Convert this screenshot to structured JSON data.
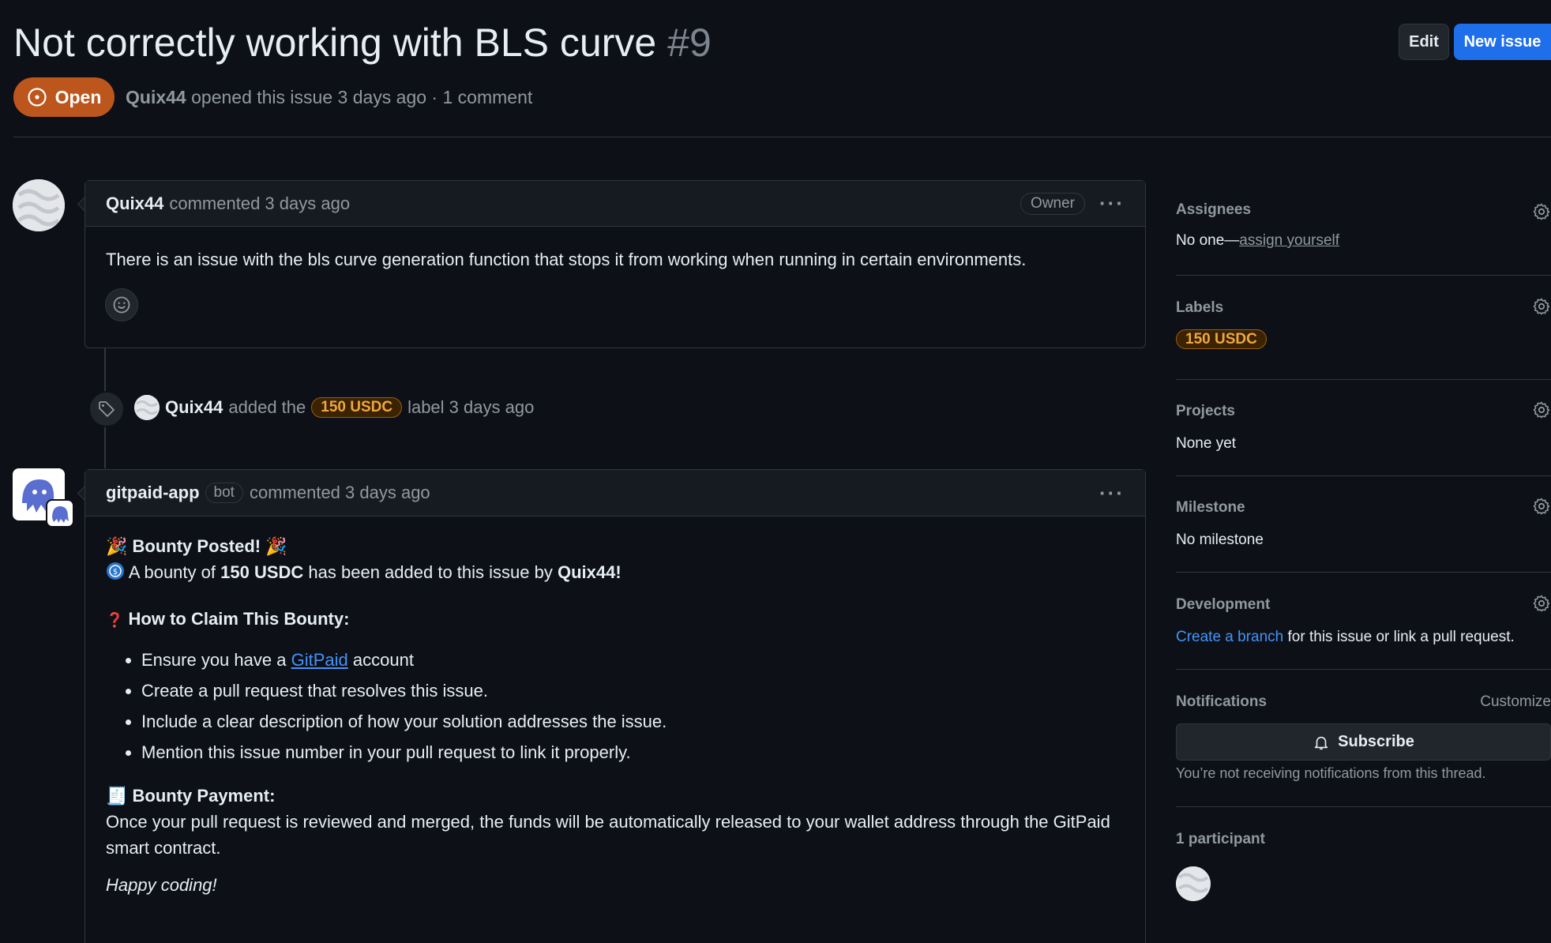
{
  "issue": {
    "title": "Not correctly working with BLS curve",
    "number": "#9",
    "state": "Open",
    "author": "Quix44",
    "meta_text": "opened this issue 3 days ago · 1 comment"
  },
  "header_buttons": {
    "edit": "Edit",
    "new_issue": "New issue"
  },
  "first_comment": {
    "author": "Quix44",
    "time": "commented 3 days ago",
    "role_badge": "Owner",
    "body": "There is an issue with the bls curve generation function that stops it from working when running in certain environments."
  },
  "label_event": {
    "actor": "Quix44",
    "text_before": "added the",
    "label": "150 USDC",
    "text_after": "label 3 days ago"
  },
  "bot_comment": {
    "author": "gitpaid-app",
    "badge": "bot",
    "time": "commented 3 days ago",
    "heading": "Bounty Posted!",
    "party_emoji": "🎉",
    "bounty_line": {
      "prefix": "A bounty of",
      "amount": "150 USDC",
      "middle": "has been added to this issue by",
      "user": "Quix44!"
    },
    "claim_heading": "How to Claim This Bounty:",
    "question_emoji": "❓",
    "steps": {
      "s1_prefix": "Ensure you have a",
      "s1_link": "GitPaid",
      "s1_suffix": "account",
      "s2": "Create a pull request that resolves this issue.",
      "s3": "Include a clear description of how your solution addresses the issue.",
      "s4": "Mention this issue number in your pull request to link it properly."
    },
    "payment_heading": "Bounty Payment:",
    "payment_emoji": "🧾",
    "payment_text": "Once your pull request is reviewed and merged, the funds will be automatically released to your wallet address through the GitPaid smart contract.",
    "closing": "Happy coding!"
  },
  "sidebar": {
    "assignees": {
      "title": "Assignees",
      "value_prefix": "No one—",
      "link": "assign yourself"
    },
    "labels": {
      "title": "Labels",
      "label": "150 USDC"
    },
    "projects": {
      "title": "Projects",
      "value": "None yet"
    },
    "milestone": {
      "title": "Milestone",
      "value": "No milestone"
    },
    "development": {
      "title": "Development",
      "link": "Create a branch",
      "suffix": "for this issue or link a pull request."
    },
    "notifications": {
      "title": "Notifications",
      "customize": "Customize",
      "subscribe": "Subscribe",
      "note": "You’re not receiving notifications from this thread."
    },
    "participants": {
      "title": "1 participant"
    }
  },
  "colors": {
    "background": "#0d1117",
    "open_state": "#bd561d",
    "primary_button": "#1f6feb",
    "link": "#4493f8",
    "label_text": "#f0a742"
  }
}
